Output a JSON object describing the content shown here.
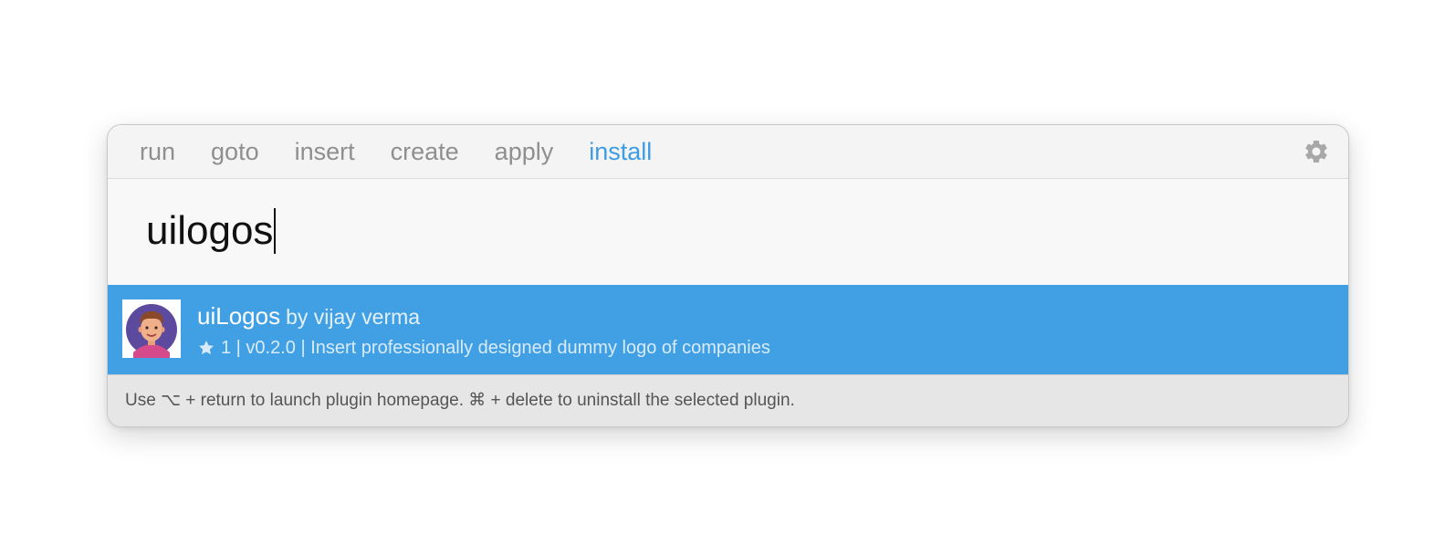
{
  "tabs": [
    {
      "label": "run",
      "active": false
    },
    {
      "label": "goto",
      "active": false
    },
    {
      "label": "insert",
      "active": false
    },
    {
      "label": "create",
      "active": false
    },
    {
      "label": "apply",
      "active": false
    },
    {
      "label": "install",
      "active": true
    }
  ],
  "settings_icon": "gear-icon",
  "search": {
    "value": "uilogos"
  },
  "result": {
    "name": "uiLogos",
    "by": "by vijay verma",
    "star_icon": "star-icon",
    "meta": "1 | v0.2.0 | Insert professionally designed dummy logo of companies",
    "thumbnail_icon": "avatar-icon"
  },
  "footer": {
    "hint": "Use ⌥ + return to launch plugin homepage. ⌘ + delete to uninstall the selected plugin."
  },
  "colors": {
    "accent": "#3d9ce3",
    "selection": "#41a0e4",
    "tab_inactive": "#8f8f8f"
  }
}
